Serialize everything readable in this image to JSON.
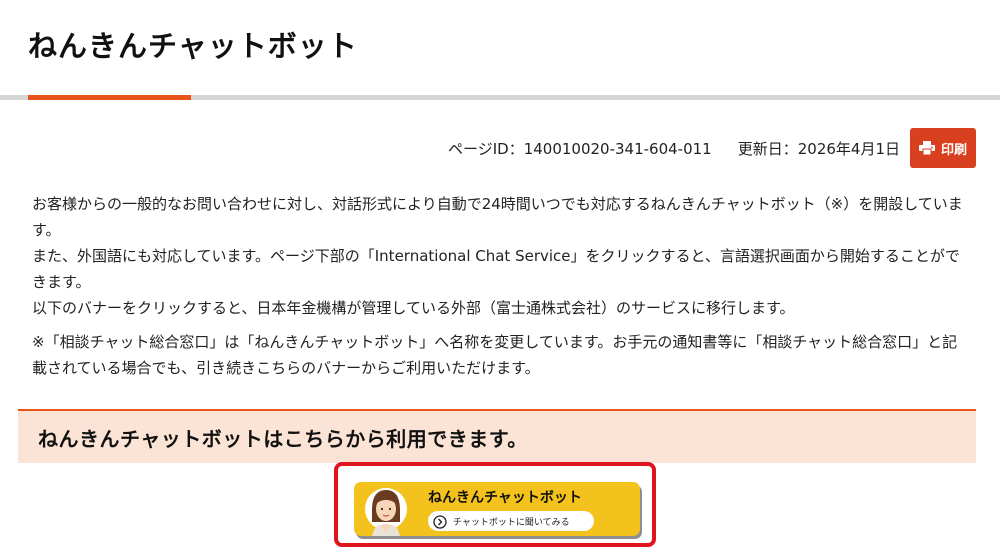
{
  "header": {
    "title": "ねんきんチャットボット"
  },
  "meta": {
    "page_id": "ページID：140010020-341-604-011",
    "updated": "更新日：2026年4月1日",
    "print_label": "印刷"
  },
  "body": {
    "paragraphs": [
      "お客様からの一般的なお問い合わせに対し、対話形式により自動で24時間いつでも対応するねんきんチャットボット（※）を開設しています。",
      "また、外国語にも対応しています。ページ下部の「International Chat Service」をクリックすると、言語選択画面から開始することができます。",
      "以下のバナーをクリックすると、日本年金機構が管理している外部（富士通株式会社）のサービスに移行します。"
    ],
    "note": "※「相談チャット総合窓口」は「ねんきんチャットボット」へ名称を変更しています。お手元の通知書等に「相談チャット総合窓口」と記載されている場合でも、引き続きこちらのバナーからご利用いただけます。"
  },
  "banner_section": {
    "heading": "ねんきんチャットボットはこちらから利用できます。"
  },
  "chatbot_banner": {
    "title": "ねんきんチャットボット",
    "ask_label": "チャットボットに聞いてみる"
  },
  "colors": {
    "accent": "#e8531a",
    "print_button": "#d9401f",
    "banner_bg": "#fbe3d6",
    "highlight_frame": "#e0141e",
    "chatbot_yellow": "#f4c21c"
  }
}
